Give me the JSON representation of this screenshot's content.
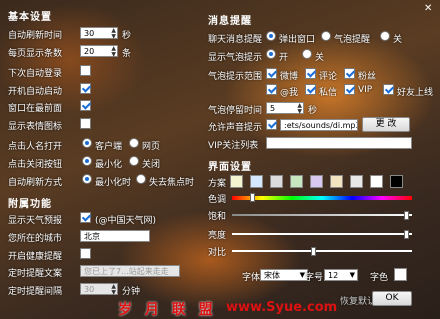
{
  "window": {
    "close_icon": "✕"
  },
  "basic": {
    "title": "基本设置",
    "refresh_label": "自动刷新时间",
    "refresh_value": "30",
    "refresh_unit": "秒",
    "per_page_label": "每页显示条数",
    "per_page_value": "20",
    "per_page_unit": "条",
    "auto_login_label": "下次自动登录",
    "auto_start_label": "开机自动启动",
    "on_top_label": "窗口在最前面",
    "emoji_label": "显示表情图标",
    "click_name_label": "点击人名打开",
    "click_name_opt1": "客户端",
    "click_name_opt2": "网页",
    "click_close_label": "点击关闭按钮",
    "click_close_opt1": "最小化",
    "click_close_opt2": "关闭",
    "auto_refresh_mode_label": "自动刷新方式",
    "auto_refresh_opt1": "最小化时",
    "auto_refresh_opt2": "失去焦点时"
  },
  "extra": {
    "title": "附属功能",
    "weather_label": "显示天气预报",
    "weather_note": "(@中国天气网)",
    "city_label": "您所在的城市",
    "city_value": "北京",
    "health_label": "开启健康提醒",
    "timer_text_label": "定时提醒文案",
    "timer_text_value": "您已上了7...站起来走走",
    "timer_interval_label": "定时提醒间隔",
    "timer_interval_value": "30",
    "timer_interval_unit": "分钟"
  },
  "notify": {
    "title": "消息提醒",
    "chat_label": "聊天消息提醒",
    "chat_opt1": "弹出窗口",
    "chat_opt2": "气泡提醒",
    "chat_opt3": "关",
    "bubble_label": "显示气泡提示",
    "bubble_opt1": "开",
    "bubble_opt2": "关",
    "range_label": "气泡提示范围",
    "range_items": [
      "微博",
      "评论",
      "粉丝",
      "@我",
      "私信",
      "VIP",
      "好友上线"
    ],
    "stay_label": "气泡停留时间",
    "stay_value": "5",
    "stay_unit": "秒",
    "sound_label": "允许声音提示",
    "sound_value": ":ets/sounds/di.mp3",
    "sound_button": "更 改",
    "vip_label": "VIP关注列表",
    "vip_value": ""
  },
  "ui": {
    "title": "界面设置",
    "scheme_label": "方案",
    "scheme_colors": [
      "#f4f4d0",
      "#d6e8ff",
      "#dcdcdc",
      "#c6e7c0",
      "#d9c8f0",
      "#f2e4c0",
      "#e8e8e8",
      "#ffffff",
      "#000000"
    ],
    "hue_label": "色调",
    "sat_label": "饱和",
    "light_label": "亮度",
    "contrast_label": "对比",
    "hue_pos": 0.1,
    "sat_pos": 0.98,
    "light_pos": 0.98,
    "contrast_pos": 0.45,
    "font_label": "字体",
    "font_value": "宋体",
    "size_label": "字号",
    "size_value": "12",
    "color_label": "字色"
  },
  "footer": {
    "restore_label": "恢复默认",
    "ok_label": "OK"
  },
  "watermark": {
    "text": "岁 月 联 盟",
    "url": "www.Syue.com"
  }
}
